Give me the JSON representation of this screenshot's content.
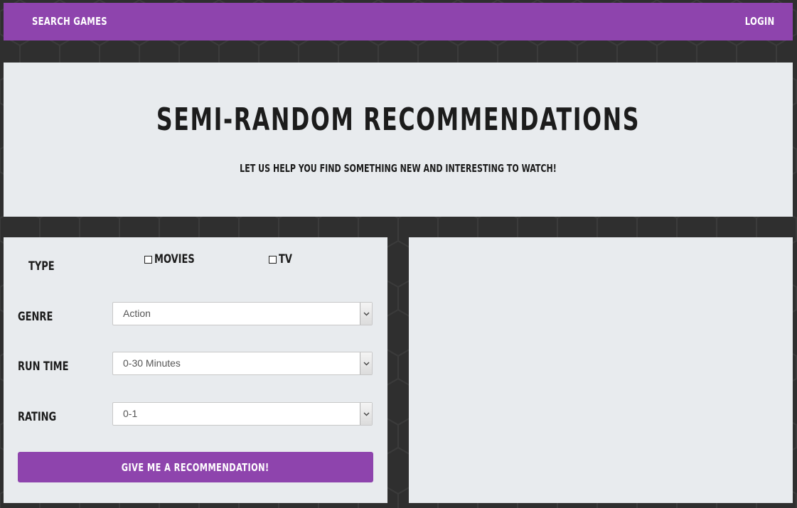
{
  "nav": {
    "search_label": "SEARCH GAMES",
    "login_label": "LOGIN"
  },
  "hero": {
    "title": "SEMI-RANDOM RECOMMENDATIONS",
    "subtitle": "LET US HELP YOU FIND SOMETHING NEW AND INTERESTING TO WATCH!"
  },
  "form": {
    "type_label": "TYPE",
    "type_options": [
      {
        "label": "MOVIES",
        "checked": false
      },
      {
        "label": "TV",
        "checked": false
      }
    ],
    "genre_label": "GENRE",
    "genre_value": "Action",
    "runtime_label": "RUN TIME",
    "runtime_value": "0-30 Minutes",
    "rating_label": "RATING",
    "rating_value": "0-1",
    "submit_label": "GIVE ME A RECOMMENDATION!"
  },
  "colors": {
    "accent": "#8e44ad",
    "background": "#2f2f2f",
    "panel": "#e8ebee"
  }
}
